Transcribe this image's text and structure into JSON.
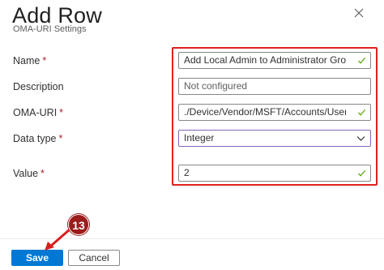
{
  "panel": {
    "title": "Add Row",
    "subtitle": "OMA-URI Settings"
  },
  "fields": {
    "name": {
      "label": "Name",
      "required": "*",
      "value": "Add Local Admin to Administrator Group"
    },
    "description": {
      "label": "Description",
      "placeholder": "Not configured"
    },
    "oma_uri": {
      "label": "OMA-URI",
      "required": "*",
      "value": "./Device/Vendor/MSFT/Accounts/Users/local..."
    },
    "data_type": {
      "label": "Data type",
      "required": "*",
      "value": "Integer"
    },
    "value": {
      "label": "Value",
      "required": "*",
      "value": "2"
    }
  },
  "footer": {
    "save_label": "Save",
    "cancel_label": "Cancel"
  },
  "annotation": {
    "step_number": "13"
  },
  "colors": {
    "accent": "#0078d4",
    "highlight": "#e02020",
    "valid_check": "#57a300",
    "step_badge": "#9b1c1c"
  },
  "icons": {
    "close": "close-icon",
    "valid": "checkmark-icon",
    "dropdown": "chevron-down-icon"
  }
}
